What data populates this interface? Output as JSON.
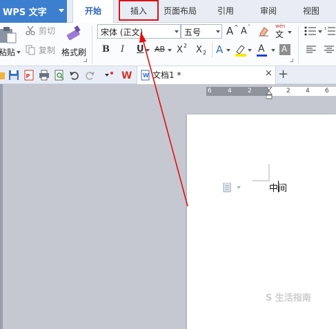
{
  "app": {
    "title": "WPS 文字"
  },
  "menu": {
    "tabs": [
      "开始",
      "插入",
      "页面布局",
      "引用",
      "审阅",
      "视图"
    ],
    "active_tab": "开始",
    "highlighted_tab": "插入"
  },
  "ribbon": {
    "paste_label": "粘贴",
    "cut_label": "剪切",
    "copy_label": "复制",
    "format_painter_label": "格式刷",
    "font_name": "宋体 (正文)",
    "font_size": "五号",
    "bold": "B",
    "italic": "I",
    "underline": "U",
    "strike": "AB",
    "superscript": "X",
    "subscript": "X",
    "sup_mark": "2",
    "sub_mark": "2",
    "grow_font": "A",
    "shrink_font": "A",
    "text_effect": "A",
    "font_color": "A",
    "char_shade": "A",
    "pinyin_top": "wén",
    "pinyin_main": "文"
  },
  "document": {
    "tab_name": "文档1 *",
    "body_text": "中间"
  },
  "ruler": {
    "ticks": [
      "6",
      "4",
      "2",
      "2",
      "4",
      "6"
    ]
  },
  "watermark": {
    "text": "S 生活指南"
  },
  "colors": {
    "brand": "#3d7fcf",
    "active_tab_text": "#2a62b8",
    "annotation": "#e01010"
  }
}
